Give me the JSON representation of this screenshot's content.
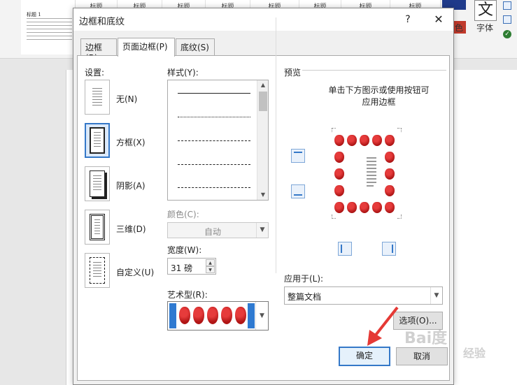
{
  "ribbon": {
    "doc_tile": {
      "title": "标题 1"
    },
    "style_tiles": [
      "标题",
      "标题",
      "标题",
      "标题",
      "标题",
      "标题",
      "标题",
      "标题"
    ],
    "group_label_color": "色",
    "group_label_font": "字体",
    "big_char": "文"
  },
  "dialog": {
    "title": "边框和底纹",
    "help": "?",
    "close": "✕",
    "tabs": [
      {
        "label": "边框(B)"
      },
      {
        "label": "页面边框(P)"
      },
      {
        "label": "底纹(S)"
      }
    ],
    "setting": {
      "label": "设置:",
      "options": [
        {
          "label": "无(N)"
        },
        {
          "label": "方框(X)"
        },
        {
          "label": "阴影(A)"
        },
        {
          "label": "三维(D)"
        },
        {
          "label": "自定义(U)"
        }
      ]
    },
    "style": {
      "label": "样式(Y):"
    },
    "color": {
      "label": "颜色(C):",
      "value": "自动"
    },
    "width": {
      "label": "宽度(W):",
      "value": "31 磅"
    },
    "art": {
      "label": "艺术型(R):"
    },
    "preview": {
      "label": "预览",
      "note_line1": "单击下方图示或使用按钮可",
      "note_line2": "应用边框"
    },
    "apply_to": {
      "label": "应用于(L):",
      "value": "整篇文档"
    },
    "options_button": "选项(O)...",
    "ok_button": "确定",
    "cancel_button": "取消"
  },
  "watermark": {
    "text": "Bai度",
    "sub": "经验"
  },
  "colors": {
    "accent": "#3478c8",
    "arrow": "#e53935",
    "apple": "#c0392b"
  }
}
